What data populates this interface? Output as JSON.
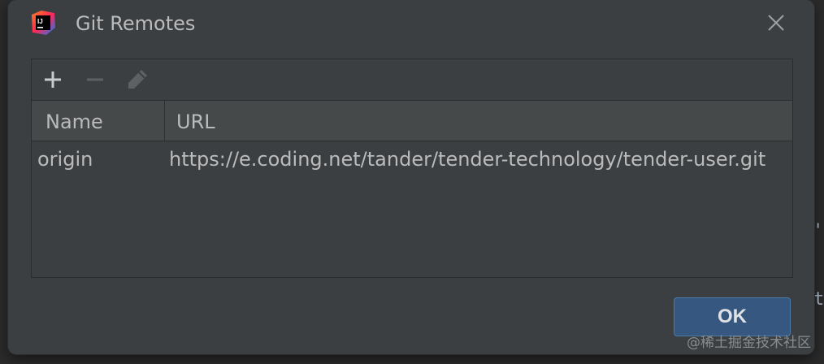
{
  "background": {
    "glyph_comma": "'",
    "glyph_t": "t"
  },
  "dialog": {
    "title": "Git Remotes",
    "app_icon": "intellij-idea-icon",
    "close_icon": "close-icon"
  },
  "toolbar": {
    "add_icon": "plus-icon",
    "remove_icon": "minus-icon",
    "edit_icon": "pencil-icon",
    "remove_enabled": false,
    "edit_enabled": false
  },
  "table": {
    "columns": [
      "Name",
      "URL"
    ],
    "rows": [
      {
        "name": "origin",
        "url": "https://e.coding.net/tander/tender-technology/tender-user.git"
      }
    ]
  },
  "buttons": {
    "ok_label": "OK"
  },
  "watermark": "@稀土掘金技术社区",
  "colors": {
    "dialog_bg": "#3c3f41",
    "header_bg": "#45494a",
    "text": "#bbbbbb",
    "ok_bg": "#365880"
  }
}
